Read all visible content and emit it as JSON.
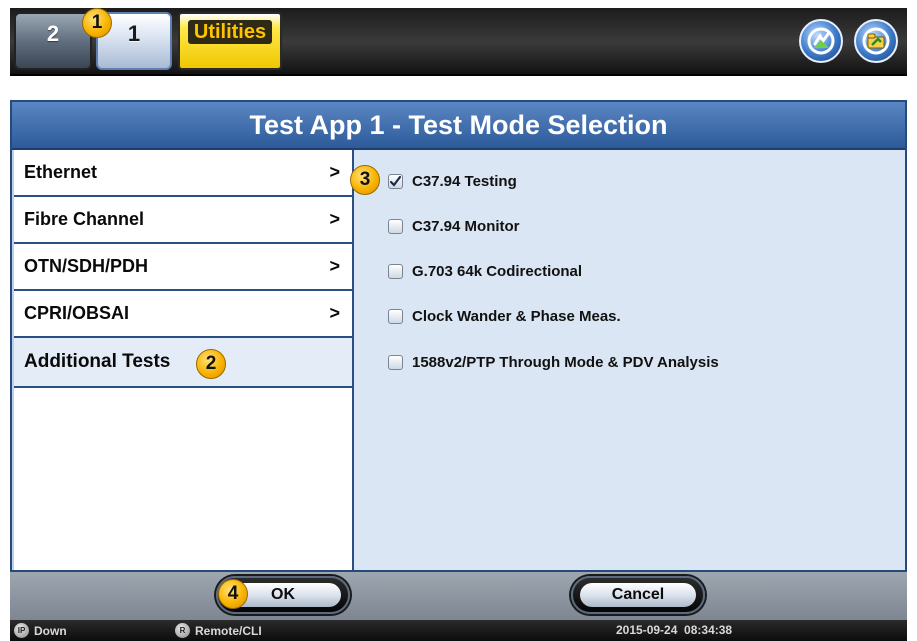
{
  "topbar": {
    "tabs": [
      {
        "label": "2"
      },
      {
        "label": "1"
      }
    ],
    "utilities_label": "Utilities",
    "icons": {
      "sync": "sync-icon",
      "files": "files-icon"
    }
  },
  "badges": {
    "b1": "1",
    "b2": "2",
    "b3": "3",
    "b4": "4"
  },
  "dialog": {
    "title": "Test App 1 - Test Mode Selection",
    "categories": [
      {
        "label": "Ethernet",
        "arrow": ">"
      },
      {
        "label": "Fibre Channel",
        "arrow": ">"
      },
      {
        "label": "OTN/SDH/PDH",
        "arrow": ">"
      },
      {
        "label": "CPRI/OBSAI",
        "arrow": ">"
      },
      {
        "label": "Additional Tests"
      }
    ],
    "options": [
      {
        "label": "C37.94 Testing",
        "checked": true
      },
      {
        "label": "C37.94 Monitor",
        "checked": false
      },
      {
        "label": "G.703 64k Codirectional",
        "checked": false
      },
      {
        "label": "Clock Wander & Phase Meas.",
        "checked": false
      },
      {
        "label": "1588v2/PTP Through Mode & PDV Analysis",
        "checked": false
      }
    ]
  },
  "buttons": {
    "ok": "OK",
    "cancel": "Cancel"
  },
  "status": {
    "ip_icon": "IP",
    "ip_status": "Down",
    "remote_icon": "R",
    "remote_label": "Remote/CLI",
    "datetime": "2015-09-24  08:34:38"
  },
  "colors": {
    "title_bar": "#2d5a98",
    "panel_bg": "#dbe6f4",
    "badge": "#f8b300",
    "utilities": "#ffe84a"
  }
}
